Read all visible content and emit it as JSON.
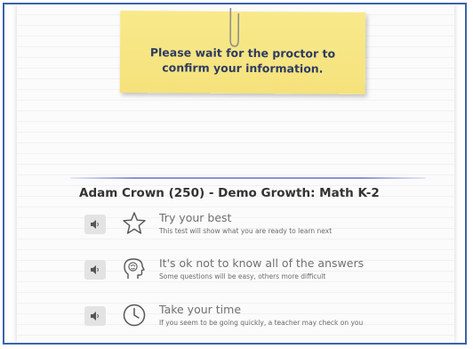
{
  "notice": {
    "line1": "Please wait for the proctor to",
    "line2": "confirm your information."
  },
  "test": {
    "title": "Adam Crown (250) - Demo Growth: Math K-2"
  },
  "tips": [
    {
      "icon": "star-icon",
      "title": "Try your best",
      "subtitle": "This test will show what you are ready to learn next"
    },
    {
      "icon": "head-brain-icon",
      "title": "It's ok not to know all of the answers",
      "subtitle": "Some questions will be easy, others more difficult"
    },
    {
      "icon": "clock-icon",
      "title": "Take your time",
      "subtitle": "If you seem to be going quickly, a teacher may check on you"
    }
  ],
  "colors": {
    "frame_border": "#3b63a8",
    "sticky_note": "#f6e47f",
    "divider": "#8b93d6",
    "title_text": "#333333"
  }
}
